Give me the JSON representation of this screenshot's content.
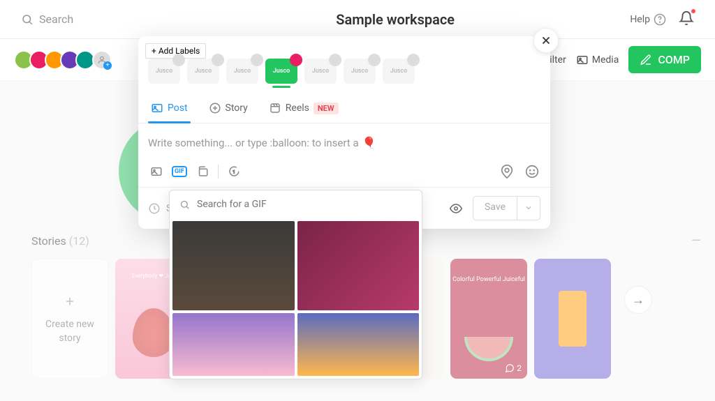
{
  "header": {
    "search_placeholder": "Search",
    "title": "Sample workspace",
    "help_label": "Help"
  },
  "subheader": {
    "filter_label": "Filter",
    "media_label": "Media",
    "compose_label": "COMP",
    "more_icon": "..."
  },
  "stories": {
    "title": "Stories",
    "count": "(12)",
    "create_label": "Create new story",
    "collapse": "—",
    "cards": [
      {
        "type": "strawberry",
        "text": "Everybody ❤ Juic"
      },
      {
        "type": "night"
      },
      {
        "type": "papaya"
      },
      {
        "type": "melon",
        "text": "Colorful Powerful Juiceful",
        "comment_count": "2"
      },
      {
        "type": "juice"
      }
    ]
  },
  "modal": {
    "add_labels": "Add Labels",
    "accounts": [
      {
        "label": "Jusco",
        "platform": "facebook",
        "active": false
      },
      {
        "label": "Jusco",
        "platform": "twitter",
        "active": false
      },
      {
        "label": "Jusco",
        "platform": "linkedin",
        "active": false
      },
      {
        "label": "Jusco",
        "platform": "instagram",
        "active": true
      },
      {
        "label": "Jusco",
        "platform": "instagram2",
        "active": false
      },
      {
        "label": "Jusco",
        "platform": "youtube",
        "active": false
      },
      {
        "label": "Jusco",
        "platform": "tiktok",
        "active": false
      }
    ],
    "tabs": [
      {
        "label": "Post",
        "active": true
      },
      {
        "label": "Story",
        "active": false
      },
      {
        "label": "Reels",
        "active": false,
        "badge": "NEW"
      }
    ],
    "editor_placeholder": "Write something... or type :balloon: to insert a",
    "balloon_emoji": "🎈",
    "schedule_label": "S",
    "save_label": "Save"
  },
  "gif_panel": {
    "search_placeholder": "Search for a GIF"
  }
}
